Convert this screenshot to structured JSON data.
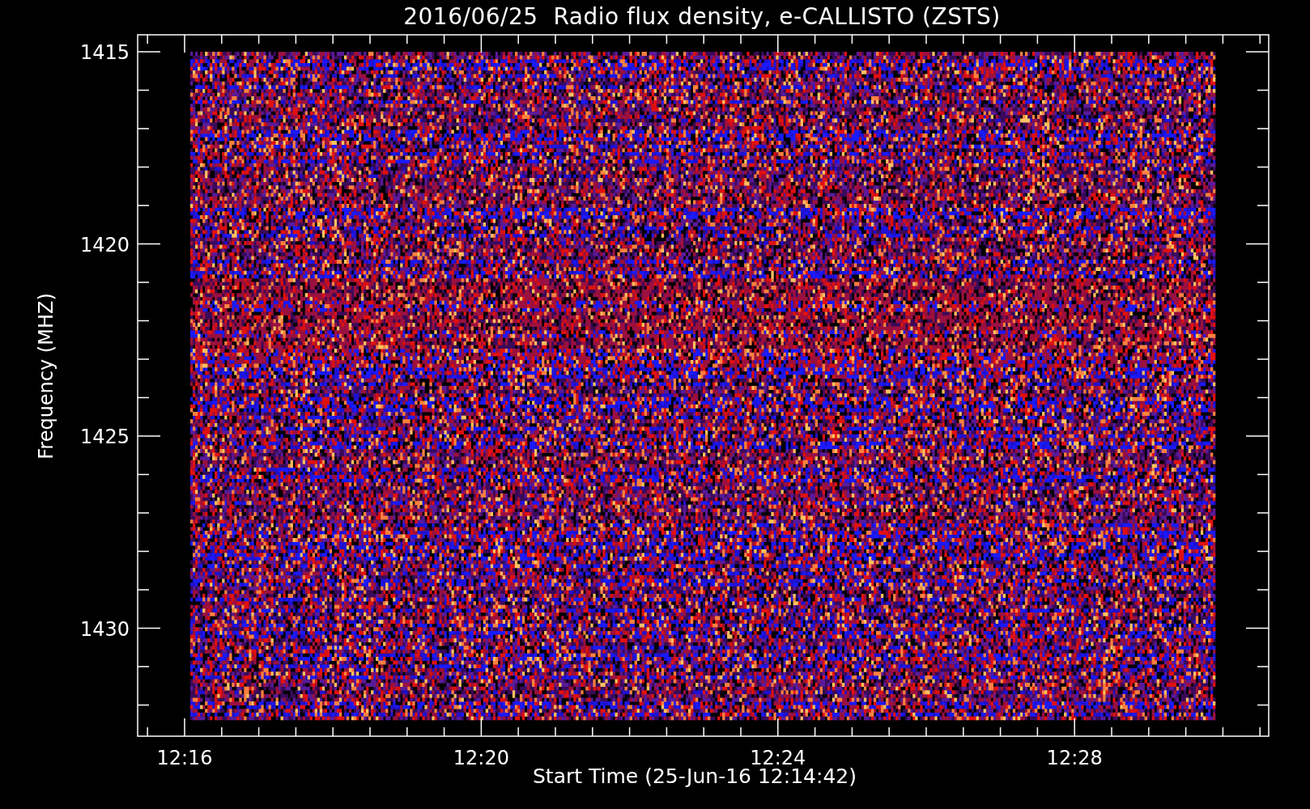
{
  "title": "2016/06/25  Radio flux density, e-CALLISTO (ZSTS)",
  "plot": {
    "ylabel": "Frequency (MHZ)",
    "xlabel": "Start Time (25-Jun-16 12:14:42)",
    "yticks": [
      "1415",
      "1420",
      "1425",
      "1430"
    ],
    "xticks": [
      "12:16",
      "12:20",
      "12:24",
      "12:28"
    ]
  }
}
